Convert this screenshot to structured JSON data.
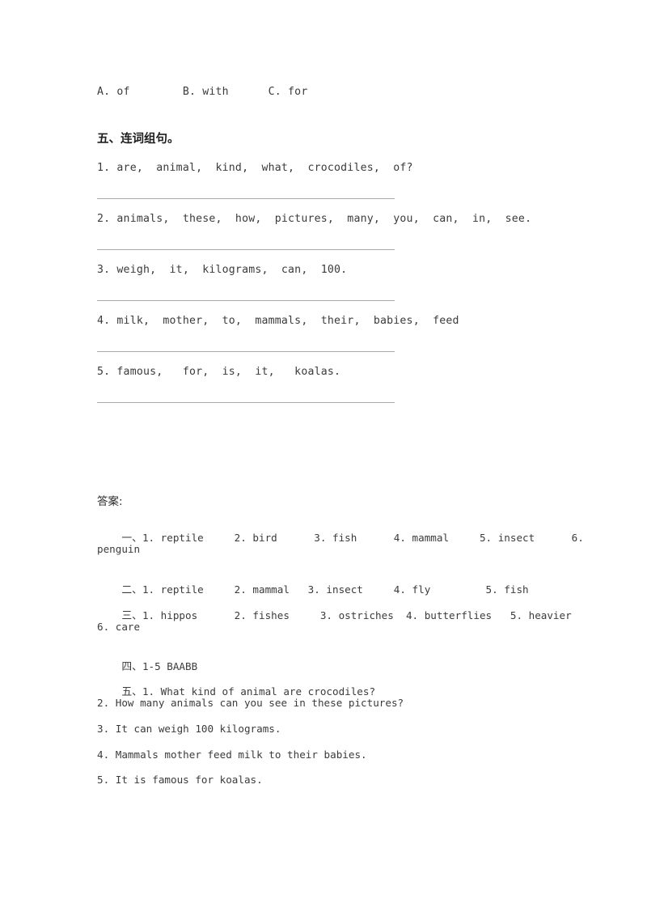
{
  "document": {
    "background_color": "#ffffff",
    "rule_color": "#a9a9a9",
    "text_color": "#3b3b3b"
  },
  "top_options": {
    "line": "A. of        B. with      C. for"
  },
  "section_five": {
    "heading": "五、连词组句。",
    "questions": [
      {
        "number": "1.",
        "text": "1. are,  animal,  kind,  what,  crocodiles,  of?"
      },
      {
        "number": "2.",
        "text": "2. animals,  these,  how,  pictures,  many,  you,  can,  in,  see."
      },
      {
        "number": "3.",
        "text": "3. weigh,  it,  kilograms,  can,  100."
      },
      {
        "number": "4.",
        "text": "4. milk,  mother,  to,  mammals,  their,  babies,  feed"
      },
      {
        "number": "5.",
        "text": "5. famous,   for,  is,  it,   koalas."
      }
    ]
  },
  "answer_key": {
    "heading": "答案:",
    "sections": [
      {
        "marker": "一、",
        "body": "1. reptile     2. bird      3. fish      4. mammal     5. insect      6.",
        "continuation": "penguin"
      },
      {
        "marker": "二、",
        "body": "1. reptile     2. mammal   3. insect     4. fly         5. fish",
        "continuation": ""
      },
      {
        "marker": "三、",
        "body": "1. hippos      2. fishes     3. ostriches  4. butterflies   5. heavier",
        "continuation": "6. care"
      },
      {
        "marker": "四、",
        "body": "1-5 BAABB",
        "continuation": ""
      },
      {
        "marker": "五、",
        "body": "1. What kind of animal are crocodiles?",
        "continuation": ""
      }
    ],
    "section_five_sentences": [
      "2. How many animals can you see in these pictures?",
      "3. It can weigh 100 kilograms.",
      "4. Mammals mother feed milk to their babies.",
      "5. It is famous for koalas."
    ]
  }
}
